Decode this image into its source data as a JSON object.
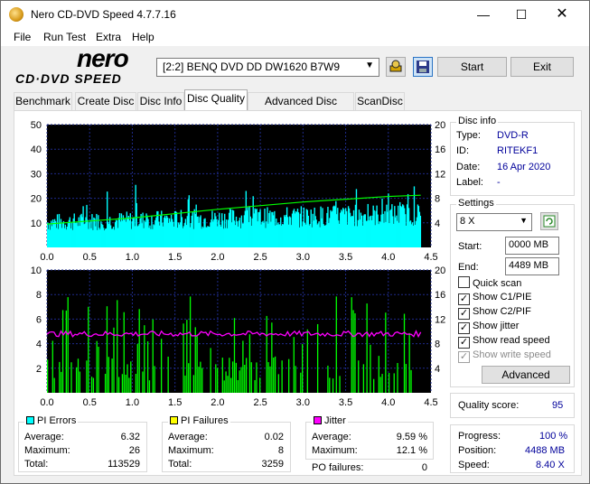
{
  "window": {
    "title": "Nero CD-DVD Speed 4.7.7.16"
  },
  "menu": [
    "File",
    "Run Test",
    "Extra",
    "Help"
  ],
  "toolbar": {
    "logo_top": "nero",
    "logo_bottom": "CD·DVD SPEED",
    "drive": "[2:2]   BENQ DVD DD DW1620 B7W9",
    "start_label": "Start",
    "exit_label": "Exit"
  },
  "tabs": [
    "Benchmark",
    "Create Disc",
    "Disc Info",
    "Disc Quality",
    "Advanced Disc Quality",
    "ScanDisc"
  ],
  "active_tab": "Disc Quality",
  "disc_info": {
    "header": "Disc info",
    "type_label": "Type:",
    "type": "DVD-R",
    "id_label": "ID:",
    "id": "RITEKF1",
    "date_label": "Date:",
    "date": "16 Apr 2020",
    "label_label": "Label:",
    "label": "-"
  },
  "settings": {
    "header": "Settings",
    "speed": "8 X",
    "start_label": "Start:",
    "start": "0000 MB",
    "end_label": "End:",
    "end": "4489 MB",
    "quick_scan": "Quick scan",
    "show_c1": "Show C1/PIE",
    "show_c2": "Show C2/PIF",
    "show_jitter": "Show jitter",
    "show_read": "Show read speed",
    "show_write": "Show write speed",
    "advanced": "Advanced"
  },
  "quality": {
    "label": "Quality score:",
    "value": "95"
  },
  "progress": {
    "progress_label": "Progress:",
    "progress": "100 %",
    "position_label": "Position:",
    "position": "4488 MB",
    "speed_label": "Speed:",
    "speed": "8.40 X"
  },
  "pi_errors": {
    "header": "PI Errors",
    "color": "#00ffff",
    "avg_label": "Average:",
    "avg": "6.32",
    "max_label": "Maximum:",
    "max": "26",
    "total_label": "Total:",
    "total": "113529"
  },
  "pi_failures": {
    "header": "PI Failures",
    "color": "#ffff00",
    "avg_label": "Average:",
    "avg": "0.02",
    "max_label": "Maximum:",
    "max": "8",
    "total_label": "Total:",
    "total": "3259"
  },
  "jitter": {
    "header": "Jitter",
    "color": "#ff00ff",
    "avg_label": "Average:",
    "avg": "9.59 %",
    "max_label": "Maximum:",
    "max": "12.1 %",
    "po_label": "PO failures:",
    "po": "0"
  },
  "chart_data": [
    {
      "type": "area",
      "x_ticks": [
        "0.0",
        "0.5",
        "1.0",
        "1.5",
        "2.0",
        "2.5",
        "3.0",
        "3.5",
        "4.0",
        "4.5"
      ],
      "y_left_ticks": [
        "50",
        "40",
        "30",
        "20",
        "10"
      ],
      "y_right_ticks": [
        "20",
        "16",
        "12",
        "8",
        "4"
      ],
      "xlim": [
        0,
        4.5
      ],
      "ylim_left": [
        0,
        50
      ],
      "ylim_right": [
        0,
        20
      ],
      "series": [
        {
          "color": "#00ffff",
          "x_range": [
            0,
            4.38
          ],
          "y_start_approx": 12,
          "y_end_approx": 16,
          "y_max": 26
        },
        {
          "color": "#00ff00",
          "x": [
            0,
            1,
            2,
            3,
            4,
            4.38
          ],
          "y": [
            3.8,
            4.8,
            6.2,
            7.4,
            8.3,
            8.5
          ]
        }
      ]
    },
    {
      "type": "bar",
      "x_ticks": [
        "0.0",
        "0.5",
        "1.0",
        "1.5",
        "2.0",
        "2.5",
        "3.0",
        "3.5",
        "4.0",
        "4.5"
      ],
      "y_left_ticks": [
        "10",
        "8",
        "6",
        "4",
        "2"
      ],
      "y_right_ticks": [
        "20",
        "16",
        "12",
        "8",
        "4"
      ],
      "xlim": [
        0,
        4.5
      ],
      "ylim_left": [
        0,
        10
      ],
      "ylim_right": [
        0,
        20
      ],
      "series": [
        {
          "color": "#00ff00",
          "x_range": [
            0,
            4.38
          ],
          "y_max": 8
        },
        {
          "color": "#ff00ff",
          "x_range": [
            0,
            4.38
          ],
          "y_approx": 9.6
        }
      ]
    }
  ]
}
